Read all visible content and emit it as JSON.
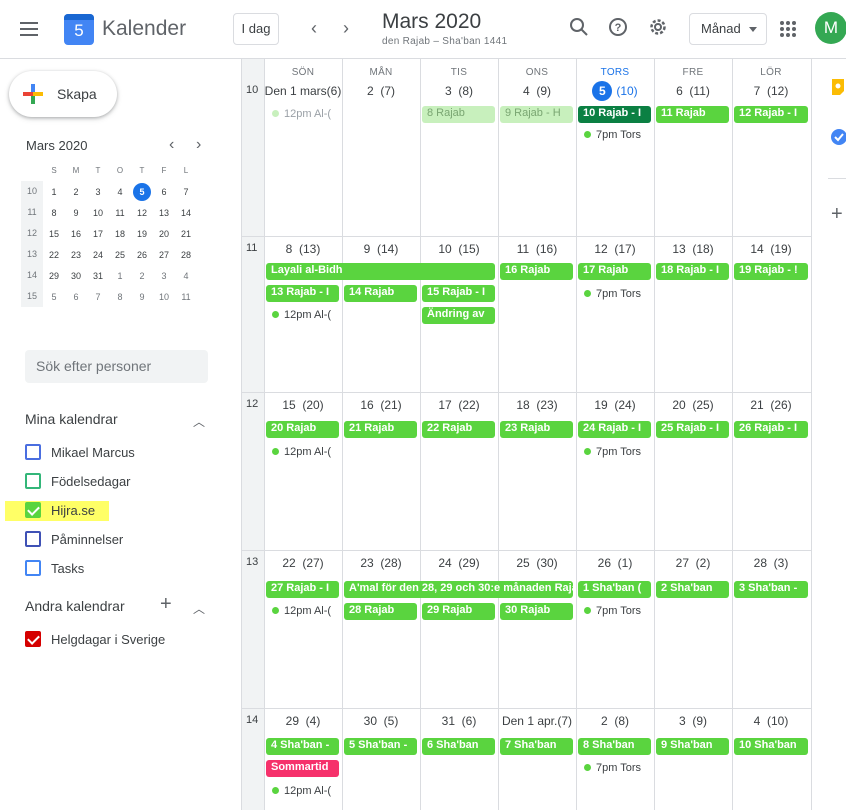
{
  "header": {
    "app_title": "Kalender",
    "logo_day": "5",
    "today_label": "I dag",
    "month_title": "Mars 2020",
    "month_subtitle": "den Rajab – Sha'ban 1441",
    "view_label": "Månad",
    "avatar_letter": "M"
  },
  "sidebar": {
    "create_label": "Skapa",
    "mini_title": "Mars 2020",
    "mini_headers": [
      "S",
      "M",
      "T",
      "O",
      "T",
      "F",
      "L"
    ],
    "mini_weeks": [
      {
        "wk": "10",
        "days": [
          "1",
          "2",
          "3",
          "4",
          "5",
          "6",
          "7"
        ]
      },
      {
        "wk": "11",
        "days": [
          "8",
          "9",
          "10",
          "11",
          "12",
          "13",
          "14"
        ]
      },
      {
        "wk": "12",
        "days": [
          "15",
          "16",
          "17",
          "18",
          "19",
          "20",
          "21"
        ]
      },
      {
        "wk": "13",
        "days": [
          "22",
          "23",
          "24",
          "25",
          "26",
          "27",
          "28"
        ]
      },
      {
        "wk": "14",
        "days": [
          "29",
          "30",
          "31",
          "1",
          "2",
          "3",
          "4"
        ]
      },
      {
        "wk": "15",
        "days": [
          "5",
          "6",
          "7",
          "8",
          "9",
          "10",
          "11"
        ]
      }
    ],
    "search_placeholder": "Sök efter personer",
    "my_calendars_title": "Mina kalendrar",
    "my_calendars": [
      {
        "label": "Mikael Marcus",
        "color": "#4a6ee0",
        "checked": false
      },
      {
        "label": "Födelsedagar",
        "color": "#33b679",
        "checked": false
      },
      {
        "label": "Hijra.se",
        "color": "#5ad43f",
        "checked": true
      },
      {
        "label": "Påminnelser",
        "color": "#3f51b5",
        "checked": false
      },
      {
        "label": "Tasks",
        "color": "#4285f4",
        "checked": false
      }
    ],
    "other_calendars_title": "Andra kalendrar",
    "other_calendars": [
      {
        "label": "Helgdagar i Sverige",
        "color": "#d50000",
        "checked": true
      }
    ]
  },
  "calendar": {
    "day_headers": [
      "SÖN",
      "MÅN",
      "TIS",
      "ONS",
      "TORS",
      "FRE",
      "LÖR"
    ],
    "weeks": [
      {
        "wk": "10",
        "dates": [
          "Den 1 mars(6)",
          "2  (7)",
          "3  (8)",
          "4  (9)",
          "5",
          "6  (11)",
          "7  (12)"
        ]
      },
      {
        "wk": "11",
        "dates": [
          "8  (13)",
          "9  (14)",
          "10  (15)",
          "11  (16)",
          "12  (17)",
          "13  (18)",
          "14  (19)"
        ]
      },
      {
        "wk": "12",
        "dates": [
          "15  (20)",
          "16  (21)",
          "17  (22)",
          "18  (23)",
          "19  (24)",
          "20  (25)",
          "21  (26)"
        ]
      },
      {
        "wk": "13",
        "dates": [
          "22  (27)",
          "23  (28)",
          "24  (29)",
          "25  (30)",
          "26  (1)",
          "27  (2)",
          "28  (3)"
        ]
      },
      {
        "wk": "14",
        "dates": [
          "29  (4)",
          "30  (5)",
          "31  (6)",
          "Den 1 apr.(7)",
          "2  (8)",
          "3  (9)",
          "4  (10)"
        ]
      }
    ],
    "today_num": "5",
    "today_hijri": "(10)",
    "events": {
      "w1": [
        "8 Rajab",
        "9 Rajab - H",
        "10 Rajab - I",
        "11 Rajab",
        "12 Rajab - I"
      ],
      "w1_dots": [
        "12pm Al-(",
        "7pm Tors"
      ],
      "w2": [
        "Layali al-Bidh",
        "16 Rajab",
        "17 Rajab",
        "18 Rajab - I",
        "19 Rajab - !",
        "13 Rajab - I",
        "14 Rajab",
        "15 Rajab - I",
        "Ändring av"
      ],
      "w2_dots": [
        "12pm Al-(",
        "7pm Tors"
      ],
      "w3": [
        "20 Rajab",
        "21 Rajab",
        "22 Rajab",
        "23 Rajab",
        "24 Rajab - I",
        "25 Rajab - I",
        "26 Rajab - I"
      ],
      "w3_dots": [
        "12pm Al-(",
        "7pm Tors"
      ],
      "w4": [
        "27 Rajab - I",
        "A'mal för den 28, 29 och 30:e månaden Raja",
        "1 Sha'ban (",
        "2 Sha'ban",
        "3 Sha'ban -",
        "28 Rajab",
        "29 Rajab",
        "30 Rajab"
      ],
      "w4_dots": [
        "12pm Al-(",
        "7pm Tors"
      ],
      "w5": [
        "4 Sha'ban -",
        "5 Sha'ban -",
        "6 Sha'ban",
        "7 Sha'ban",
        "8 Sha'ban",
        "9 Sha'ban",
        "10 Sha'ban",
        "Sommartid"
      ],
      "w5_dots": [
        "12pm Al-(",
        "7pm Tors"
      ]
    }
  },
  "colors": {
    "accent": "#1a73e8",
    "event_green": "#5ad43f",
    "event_dark": "#0b8043",
    "holiday": "#f6316b"
  }
}
